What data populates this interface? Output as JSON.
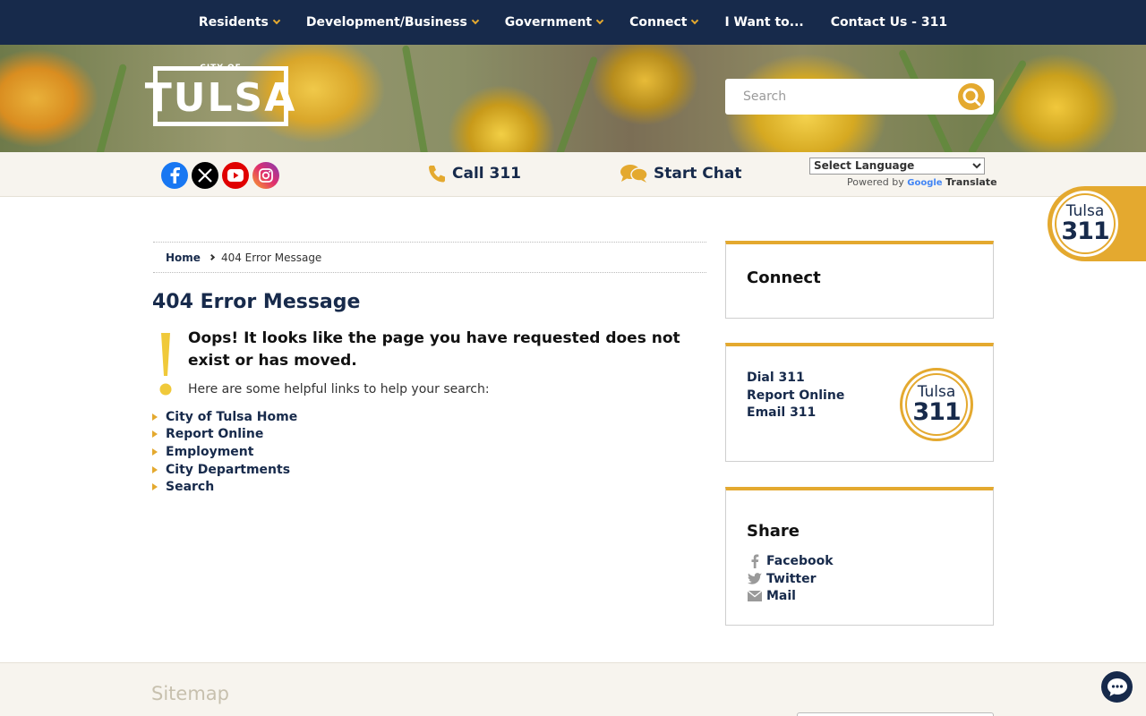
{
  "nav": {
    "items": [
      {
        "label": "Residents",
        "dropdown": true
      },
      {
        "label": "Development/Business",
        "dropdown": true
      },
      {
        "label": "Government",
        "dropdown": true
      },
      {
        "label": "Connect",
        "dropdown": true
      },
      {
        "label": "I Want to...",
        "dropdown": false
      },
      {
        "label": "Contact Us - 311",
        "dropdown": false
      }
    ]
  },
  "header": {
    "logo_top": "CITY OF",
    "logo_main": "TULSA",
    "search_placeholder": "Search"
  },
  "utility": {
    "social_icons": [
      "facebook-icon",
      "x-icon",
      "youtube-icon",
      "instagram-icon"
    ],
    "call_label": "Call 311",
    "chat_label": "Start Chat",
    "language_selected": "Select Language",
    "powered_by": "Powered by",
    "google": "Google",
    "translate": "Translate"
  },
  "floating_badge": {
    "line1": "Tulsa",
    "line2": "311"
  },
  "breadcrumb": {
    "home": "Home",
    "current": "404 Error Message"
  },
  "main": {
    "title": "404 Error Message",
    "message": "Oops! It looks like the page you have requested does not exist or has moved.",
    "helpful_text": "Here are some helpful links to help your search:",
    "links": [
      "City of Tulsa Home",
      "Report Online",
      "Employment",
      "City Departments",
      "Search"
    ]
  },
  "sidebar": {
    "connect_title": "Connect",
    "contact_links": [
      "Dial 311",
      "Report Online",
      "Email 311"
    ],
    "badge": {
      "line1": "Tulsa",
      "line2": "311"
    },
    "share_title": "Share",
    "share_links": [
      "Facebook",
      "Twitter",
      "Mail"
    ]
  },
  "footer": {
    "sitemap": "Sitemap"
  },
  "colors": {
    "navy": "#172a4b",
    "gold": "#e4a92f",
    "cream": "#f7f4ee"
  }
}
